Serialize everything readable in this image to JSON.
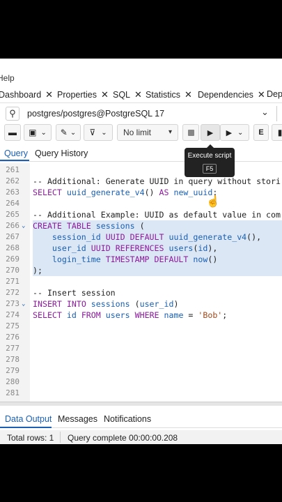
{
  "menubar": {
    "help_label": "Help"
  },
  "tabs": [
    {
      "label": "Dashboard"
    },
    {
      "label": "Properties"
    },
    {
      "label": "SQL"
    },
    {
      "label": "Statistics"
    },
    {
      "label": "Dependencies"
    },
    {
      "label": "Dep"
    }
  ],
  "connection": {
    "label": "postgres/postgres@PostgreSQL 17"
  },
  "toolbar": {
    "limit_label": "No limit"
  },
  "tooltip": {
    "title": "Execute script",
    "key": "F5"
  },
  "query_tabs": [
    {
      "label": "Query"
    },
    {
      "label": "Query History"
    }
  ],
  "editor": {
    "lines": [
      {
        "num": "261",
        "code": ""
      },
      {
        "num": "262",
        "code": "-- Additional: Generate UUID in query without stori"
      },
      {
        "num": "263",
        "code": "SELECT uuid_generate_v4() AS new_uuid;"
      },
      {
        "num": "264",
        "code": ""
      },
      {
        "num": "265",
        "code": "-- Additional Example: UUID as default value in com"
      },
      {
        "num": "266",
        "code": "CREATE TABLE sessions ("
      },
      {
        "num": "267",
        "code": "    session_id UUID DEFAULT uuid_generate_v4(),"
      },
      {
        "num": "268",
        "code": "    user_id UUID REFERENCES users(id),"
      },
      {
        "num": "269",
        "code": "    login_time TIMESTAMP DEFAULT now()"
      },
      {
        "num": "270",
        "code": ");"
      },
      {
        "num": "271",
        "code": ""
      },
      {
        "num": "272",
        "code": "-- Insert session"
      },
      {
        "num": "273",
        "code": "INSERT INTO sessions (user_id)"
      },
      {
        "num": "274",
        "code": "SELECT id FROM users WHERE name = 'Bob';"
      },
      {
        "num": "275",
        "code": ""
      },
      {
        "num": "276",
        "code": ""
      },
      {
        "num": "277",
        "code": ""
      },
      {
        "num": "278",
        "code": ""
      },
      {
        "num": "279",
        "code": ""
      },
      {
        "num": "280",
        "code": ""
      },
      {
        "num": "281",
        "code": ""
      }
    ]
  },
  "output_tabs": [
    {
      "label": "Data Output"
    },
    {
      "label": "Messages"
    },
    {
      "label": "Notifications"
    }
  ],
  "status": {
    "rows": "Total rows: 1",
    "query": "Query complete 00:00:00.208"
  },
  "colors": {
    "accent": "#1a5fb4",
    "selection": "#dbe7f5",
    "keyword": "#8b1a9c",
    "comment": "#b8860b",
    "string": "#a0471a"
  }
}
